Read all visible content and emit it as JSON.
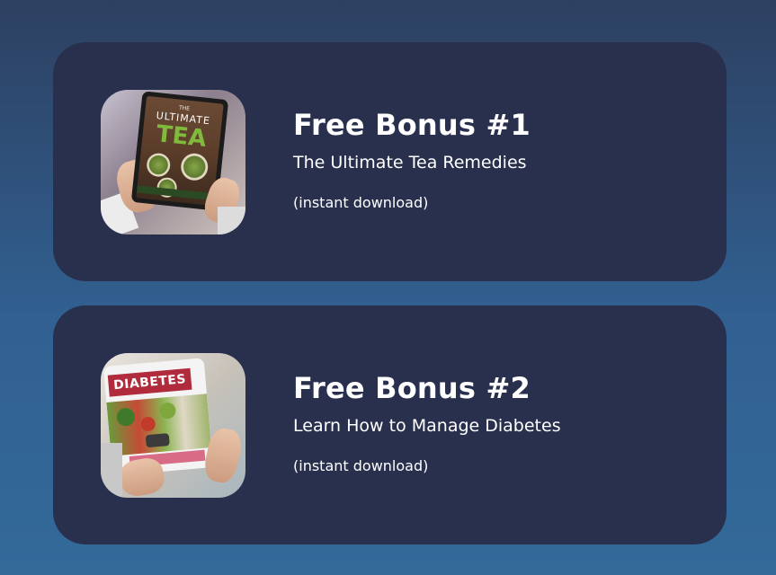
{
  "bonuses": [
    {
      "title": "Free Bonus #1",
      "subtitle": "The Ultimate Tea Remedies",
      "note": "(instant download)",
      "cover": {
        "line1": "THE",
        "line2": "ULTIMATE",
        "line3": "TEA"
      }
    },
    {
      "title": "Free Bonus #2",
      "subtitle": "Learn How to Manage Diabetes",
      "note": "(instant download)",
      "cover": {
        "header": "DIABETES"
      }
    }
  ],
  "colors": {
    "card": "#29304d",
    "background_top": "#2d4061",
    "background_bottom": "#336a9a",
    "text": "#ffffff"
  }
}
